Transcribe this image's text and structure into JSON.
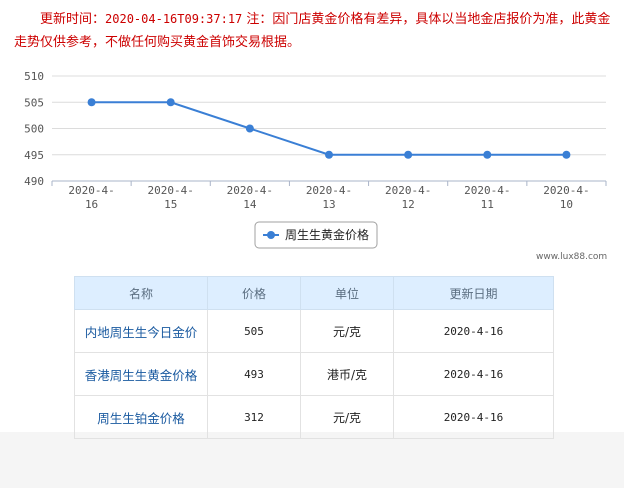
{
  "notice": {
    "label": "更新时间：",
    "time": "2020-04-16T09:37:17",
    "note": " 注：因门店黄金价格有差异，具体以当地金店报价为准，此黄金走势仅供参考，不做任何购买黄金首饰交易根据。"
  },
  "watermark": "www.lux88.com",
  "chart_data": {
    "type": "line",
    "categories": [
      "2020-4-16",
      "2020-4-15",
      "2020-4-14",
      "2020-4-13",
      "2020-4-12",
      "2020-4-11",
      "2020-4-10"
    ],
    "series": [
      {
        "name": "周生生黄金价格",
        "values": [
          505,
          505,
          500,
          495,
          495,
          495,
          495
        ]
      }
    ],
    "yticks": [
      490,
      495,
      500,
      505,
      510
    ],
    "ylim": [
      490,
      510
    ],
    "grid": true,
    "legend_position": "bottom-center",
    "line_color": "#3a7fd5"
  },
  "table": {
    "headers": [
      "名称",
      "价格",
      "单位",
      "更新日期"
    ],
    "rows": [
      {
        "name": "内地周生生今日金价",
        "price": "505",
        "unit": "元/克",
        "date": "2020-4-16"
      },
      {
        "name": "香港周生生黄金价格",
        "price": "493",
        "unit": "港币/克",
        "date": "2020-4-16"
      },
      {
        "name": "周生生铂金价格",
        "price": "312",
        "unit": "元/克",
        "date": "2020-4-16"
      }
    ]
  }
}
